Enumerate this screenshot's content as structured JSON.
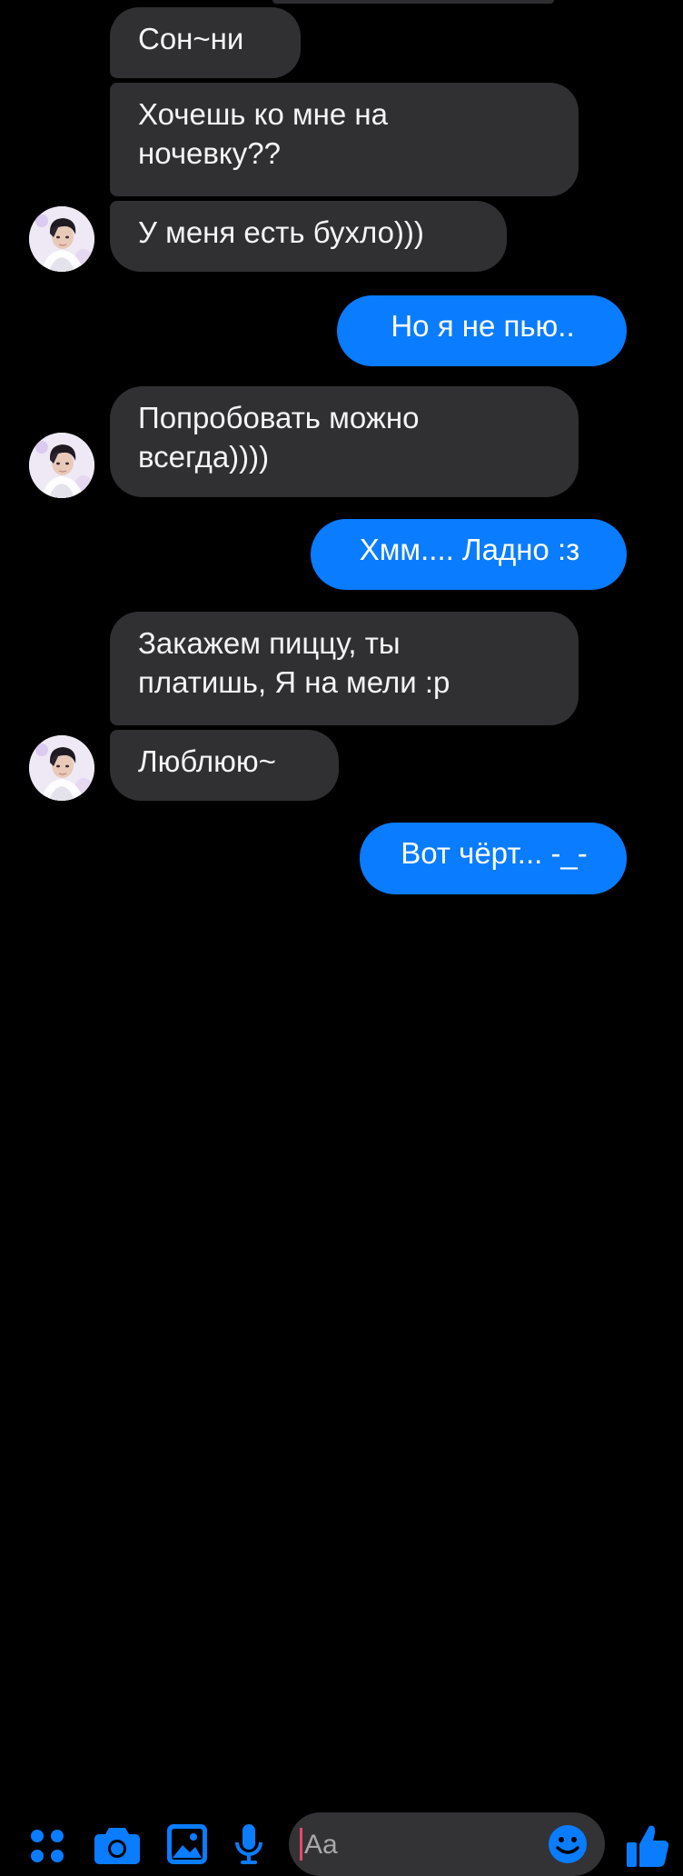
{
  "messages": [
    {
      "side": "in",
      "text": "Сон~ни"
    },
    {
      "side": "in",
      "text": "Хочешь ко мне на\nночевку??"
    },
    {
      "side": "in",
      "text": "У меня есть бухло)))"
    },
    {
      "side": "out",
      "text": "Но я  не пью.."
    },
    {
      "side": "in",
      "text": "Попробовать можно\nвсегда))))"
    },
    {
      "side": "out",
      "text": "Хмм.... Ладно :з"
    },
    {
      "side": "in",
      "text": "Закажем пиццу, ты\nплатишь, Я на мели :р"
    },
    {
      "side": "in",
      "text": "Люблюю~"
    },
    {
      "side": "out",
      "text": "Вот чёрт... -_-"
    }
  ],
  "composer": {
    "placeholder": "Aa",
    "icons": [
      "apps-icon",
      "camera-icon",
      "gallery-icon",
      "microphone-icon",
      "emoji-icon",
      "thumbs-up-icon"
    ]
  },
  "colors": {
    "background": "#000000",
    "incoming_bubble": "#303033",
    "outgoing_bubble": "#0a7cff",
    "accent": "#0a7cff"
  }
}
